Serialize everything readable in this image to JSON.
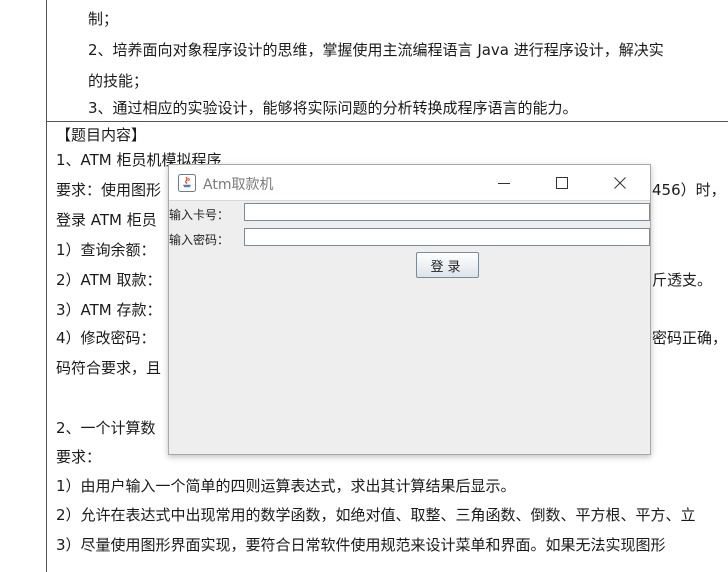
{
  "document": {
    "lines": [
      "制；",
      "2、培养面向对象程序设计的思维，掌握使用主流编程语言 Java 进行程序设计，解决实",
      "的技能；",
      "3、通过相应的实验设计，能够将实际问题的分析转换成程序语言的能力。",
      "【题目内容】",
      "1、ATM 柜员机模拟程序",
      "要求：使用图形",
      "456）时，",
      "登录 ATM 柜员",
      "1）查询余额：",
      "2）ATM 取款：",
      "斤透支。",
      "3）ATM 存款：",
      "4）修改密码：",
      "密码正确，",
      "码符合要求，且",
      "2、一个计算数",
      "要求：",
      "1）由用户输入一个简单的四则运算表达式，求出其计算结果后显示。",
      "2）允许在表达式中出现常用的数学函数，如绝对值、取整、三角函数、倒数、平方根、平方、立",
      "3）尽量使用图形界面实现，要符合日常软件使用规范来设计菜单和界面。如果无法实现图形"
    ]
  },
  "window": {
    "title": "Atm取款机",
    "controls": {
      "minimize": "minimize",
      "maximize": "maximize",
      "close": "close"
    }
  },
  "form": {
    "card_label": "输入卡号：",
    "card_value": "",
    "password_label": "输入密码：",
    "password_value": "",
    "login_label": "登录"
  }
}
